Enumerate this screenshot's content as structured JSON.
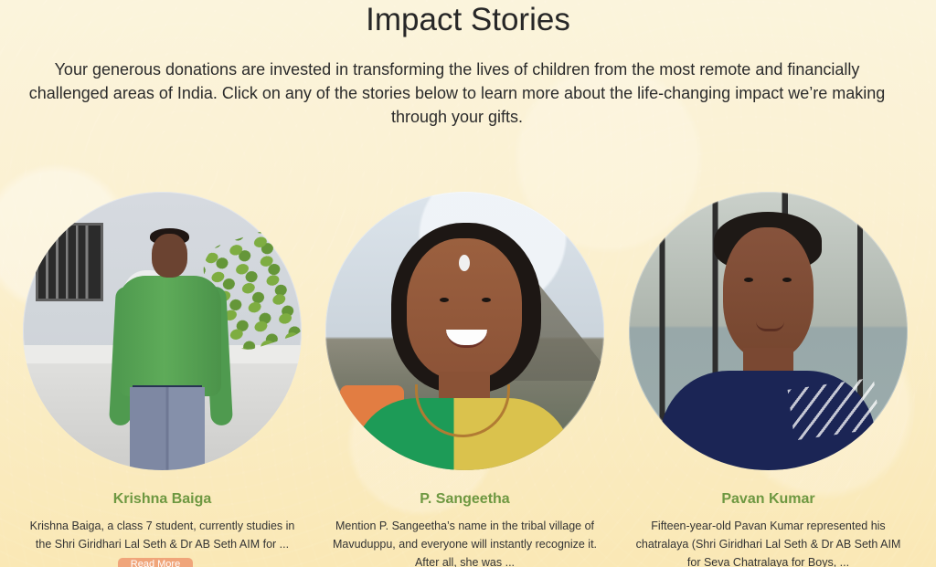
{
  "page": {
    "title": "Impact Stories",
    "intro": "Your generous donations are invested in transforming the lives of children from the most remote and financially challenged areas of India. Click on any of the stories below to learn more about the life-changing impact we’re making through your gifts."
  },
  "stories": [
    {
      "name": "Krishna Baiga",
      "excerpt": "Krishna Baiga, a class 7 student, currently studies in the Shri Giridhari Lal Seth & Dr AB Seth AIM for ...",
      "button_label": "Read More"
    },
    {
      "name": "P. Sangeetha",
      "excerpt": "Mention P. Sangeetha’s name in the tribal village of Mavuduppu, and everyone will instantly recognize it. After all, she was ..."
    },
    {
      "name": "Pavan Kumar",
      "excerpt": "Fifteen-year-old Pavan Kumar represented his chatralaya (Shri Giridhari Lal Seth & Dr AB Seth AIM for Seva Chatralaya for Boys, ..."
    }
  ],
  "colors": {
    "background": "#fbf0cf",
    "title": "#272727",
    "story_name": "#6e9841",
    "button": "#f0a57a"
  }
}
